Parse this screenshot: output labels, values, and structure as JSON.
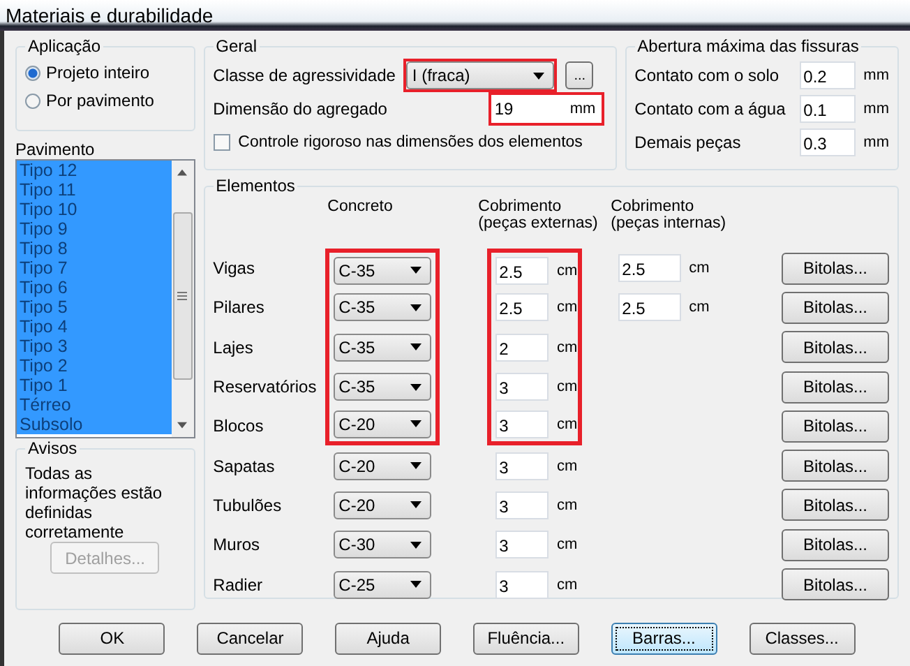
{
  "window": {
    "title": "Materiais e durabilidade"
  },
  "aplicacao": {
    "title": "Aplicação",
    "options": [
      {
        "label": "Projeto inteiro",
        "selected": true
      },
      {
        "label": "Por pavimento",
        "selected": false
      }
    ]
  },
  "pavimento": {
    "label": "Pavimento",
    "disabled": true,
    "items": [
      {
        "label": "Tipo 12",
        "selected": true
      },
      {
        "label": "Tipo 11",
        "selected": true
      },
      {
        "label": "Tipo 10",
        "selected": true
      },
      {
        "label": "Tipo 9",
        "selected": true
      },
      {
        "label": "Tipo 8",
        "selected": true
      },
      {
        "label": "Tipo 7",
        "selected": true
      },
      {
        "label": "Tipo 6",
        "selected": true
      },
      {
        "label": "Tipo 5",
        "selected": true
      },
      {
        "label": "Tipo 4",
        "selected": true
      },
      {
        "label": "Tipo 3",
        "selected": true
      },
      {
        "label": "Tipo 2",
        "selected": true
      },
      {
        "label": "Tipo 1",
        "selected": true
      },
      {
        "label": "Térreo",
        "selected": true
      },
      {
        "label": "Subsolo",
        "selected": true
      }
    ]
  },
  "avisos": {
    "title": "Avisos",
    "message": "Todas as informações estão definidas corretamente",
    "details_button": {
      "label": "Detalhes...",
      "disabled": true
    }
  },
  "geral": {
    "title": "Geral",
    "classe": {
      "label": "Classe de agressividade",
      "value": "I (fraca)",
      "highlighted": true
    },
    "more_button": "...",
    "agregado": {
      "label": "Dimensão do agregado",
      "value": "19",
      "unit": "mm",
      "highlighted": true
    },
    "controle": {
      "label": "Controle rigoroso nas dimensões dos elementos",
      "checked": false
    }
  },
  "abertura": {
    "title": "Abertura máxima das fissuras",
    "rows": [
      {
        "label": "Contato com o solo",
        "value": "0.2",
        "unit": "mm"
      },
      {
        "label": "Contato com a água",
        "value": "0.1",
        "unit": "mm"
      },
      {
        "label": "Demais peças",
        "value": "0.3",
        "unit": "mm"
      }
    ]
  },
  "elementos": {
    "title": "Elementos",
    "headers": {
      "concreto": "Concreto",
      "externo": "Cobrimento\n(peças externas)",
      "interno": "Cobrimento\n(peças internas)"
    },
    "rows": [
      {
        "label": "Vigas",
        "concreto": "C-35",
        "concreto_highlighted": true,
        "externo": "2.5",
        "externo_unit": "cm",
        "externo_highlighted": true,
        "interno": "2.5",
        "interno_unit": "cm",
        "button": "Bitolas..."
      },
      {
        "label": "Pilares",
        "concreto": "C-35",
        "concreto_highlighted": true,
        "externo": "2.5",
        "externo_unit": "cm",
        "externo_highlighted": true,
        "interno": "2.5",
        "interno_unit": "cm",
        "button": "Bitolas..."
      },
      {
        "label": "Lajes",
        "concreto": "C-35",
        "concreto_highlighted": true,
        "externo": "2",
        "externo_unit": "cm",
        "externo_highlighted": true,
        "button": "Bitolas..."
      },
      {
        "label": "Reservatórios",
        "concreto": "C-35",
        "concreto_highlighted": true,
        "externo": "3",
        "externo_unit": "cm",
        "externo_highlighted": true,
        "button": "Bitolas..."
      },
      {
        "label": "Blocos",
        "concreto": "C-20",
        "concreto_highlighted": true,
        "externo": "3",
        "externo_unit": "cm",
        "externo_highlighted": true,
        "button": "Bitolas..."
      },
      {
        "label": "Sapatas",
        "concreto": "C-20",
        "concreto_highlighted": false,
        "externo": "3",
        "externo_unit": "cm",
        "externo_highlighted": false,
        "button": "Bitolas..."
      },
      {
        "label": "Tubulões",
        "concreto": "C-20",
        "concreto_highlighted": false,
        "externo": "3",
        "externo_unit": "cm",
        "externo_highlighted": false,
        "button": "Bitolas..."
      },
      {
        "label": "Muros",
        "concreto": "C-30",
        "concreto_highlighted": false,
        "externo": "3",
        "externo_unit": "cm",
        "externo_highlighted": false,
        "button": "Bitolas..."
      },
      {
        "label": "Radier",
        "concreto": "C-25",
        "concreto_highlighted": false,
        "externo": "3",
        "externo_unit": "cm",
        "externo_highlighted": false,
        "button": "Bitolas..."
      }
    ]
  },
  "buttons": [
    {
      "label": "OK",
      "focused": false
    },
    {
      "label": "Cancelar",
      "focused": false
    },
    {
      "label": "Ajuda",
      "focused": false
    },
    {
      "label": "Fluência...",
      "focused": false
    },
    {
      "label": "Barras...",
      "focused": true
    },
    {
      "label": "Classes...",
      "focused": false
    }
  ]
}
